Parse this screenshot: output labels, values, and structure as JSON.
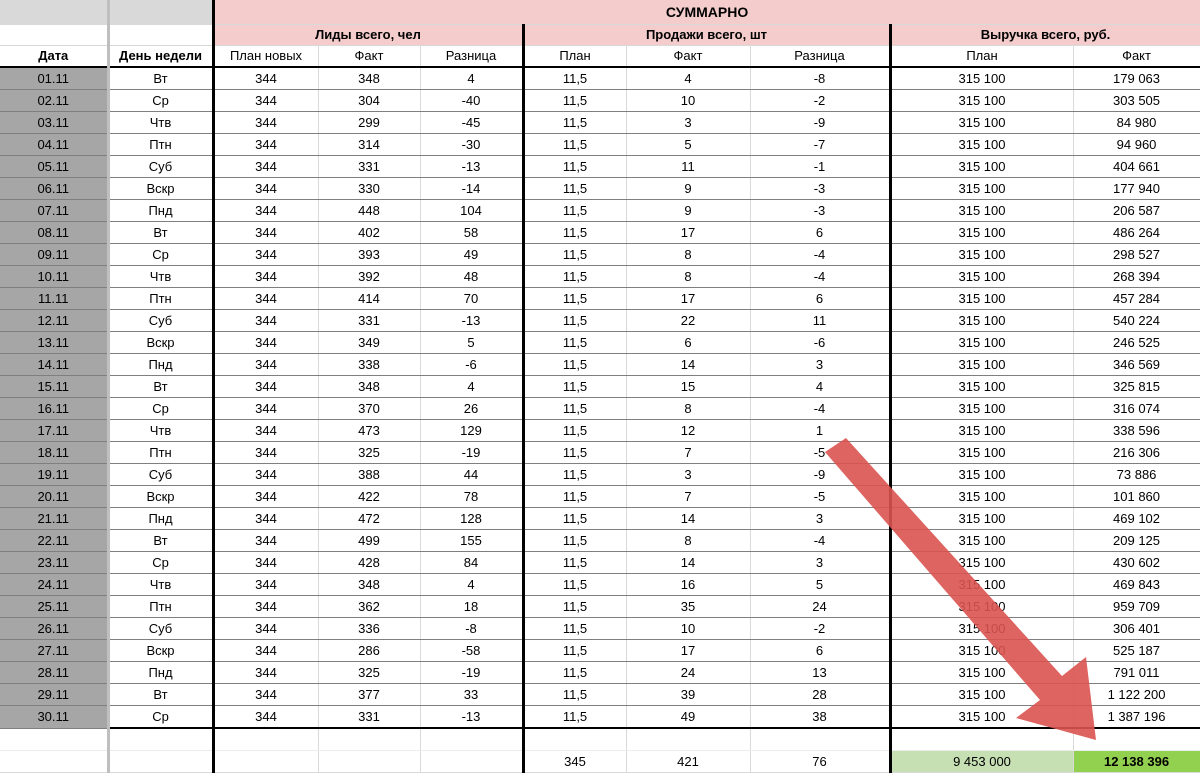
{
  "title": "СУММАРНО",
  "groups": {
    "leads": "Лиды всего, чел",
    "sales": "Продажи всего, шт",
    "revenue": "Выручка всего, руб."
  },
  "headers": {
    "date": "Дата",
    "weekday": "День недели",
    "leads_plan": "План новых",
    "leads_fact": "Факт",
    "leads_diff": "Разница",
    "sales_plan": "План",
    "sales_fact": "Факт",
    "sales_diff": "Разница",
    "rev_plan": "План",
    "rev_fact": "Факт"
  },
  "rows": [
    [
      "01.11",
      "Вт",
      "344",
      "348",
      "4",
      "11,5",
      "4",
      "-8",
      "315 100",
      "179 063"
    ],
    [
      "02.11",
      "Ср",
      "344",
      "304",
      "-40",
      "11,5",
      "10",
      "-2",
      "315 100",
      "303 505"
    ],
    [
      "03.11",
      "Чтв",
      "344",
      "299",
      "-45",
      "11,5",
      "3",
      "-9",
      "315 100",
      "84 980"
    ],
    [
      "04.11",
      "Птн",
      "344",
      "314",
      "-30",
      "11,5",
      "5",
      "-7",
      "315 100",
      "94 960"
    ],
    [
      "05.11",
      "Суб",
      "344",
      "331",
      "-13",
      "11,5",
      "11",
      "-1",
      "315 100",
      "404 661"
    ],
    [
      "06.11",
      "Вскр",
      "344",
      "330",
      "-14",
      "11,5",
      "9",
      "-3",
      "315 100",
      "177 940"
    ],
    [
      "07.11",
      "Пнд",
      "344",
      "448",
      "104",
      "11,5",
      "9",
      "-3",
      "315 100",
      "206 587"
    ],
    [
      "08.11",
      "Вт",
      "344",
      "402",
      "58",
      "11,5",
      "17",
      "6",
      "315 100",
      "486 264"
    ],
    [
      "09.11",
      "Ср",
      "344",
      "393",
      "49",
      "11,5",
      "8",
      "-4",
      "315 100",
      "298 527"
    ],
    [
      "10.11",
      "Чтв",
      "344",
      "392",
      "48",
      "11,5",
      "8",
      "-4",
      "315 100",
      "268 394"
    ],
    [
      "11.11",
      "Птн",
      "344",
      "414",
      "70",
      "11,5",
      "17",
      "6",
      "315 100",
      "457 284"
    ],
    [
      "12.11",
      "Суб",
      "344",
      "331",
      "-13",
      "11,5",
      "22",
      "11",
      "315 100",
      "540 224"
    ],
    [
      "13.11",
      "Вскр",
      "344",
      "349",
      "5",
      "11,5",
      "6",
      "-6",
      "315 100",
      "246 525"
    ],
    [
      "14.11",
      "Пнд",
      "344",
      "338",
      "-6",
      "11,5",
      "14",
      "3",
      "315 100",
      "346 569"
    ],
    [
      "15.11",
      "Вт",
      "344",
      "348",
      "4",
      "11,5",
      "15",
      "4",
      "315 100",
      "325 815"
    ],
    [
      "16.11",
      "Ср",
      "344",
      "370",
      "26",
      "11,5",
      "8",
      "-4",
      "315 100",
      "316 074"
    ],
    [
      "17.11",
      "Чтв",
      "344",
      "473",
      "129",
      "11,5",
      "12",
      "1",
      "315 100",
      "338 596"
    ],
    [
      "18.11",
      "Птн",
      "344",
      "325",
      "-19",
      "11,5",
      "7",
      "-5",
      "315 100",
      "216 306"
    ],
    [
      "19.11",
      "Суб",
      "344",
      "388",
      "44",
      "11,5",
      "3",
      "-9",
      "315 100",
      "73 886"
    ],
    [
      "20.11",
      "Вскр",
      "344",
      "422",
      "78",
      "11,5",
      "7",
      "-5",
      "315 100",
      "101 860"
    ],
    [
      "21.11",
      "Пнд",
      "344",
      "472",
      "128",
      "11,5",
      "14",
      "3",
      "315 100",
      "469 102"
    ],
    [
      "22.11",
      "Вт",
      "344",
      "499",
      "155",
      "11,5",
      "8",
      "-4",
      "315 100",
      "209 125"
    ],
    [
      "23.11",
      "Ср",
      "344",
      "428",
      "84",
      "11,5",
      "14",
      "3",
      "315 100",
      "430 602"
    ],
    [
      "24.11",
      "Чтв",
      "344",
      "348",
      "4",
      "11,5",
      "16",
      "5",
      "315 100",
      "469 843"
    ],
    [
      "25.11",
      "Птн",
      "344",
      "362",
      "18",
      "11,5",
      "35",
      "24",
      "315 100",
      "959 709"
    ],
    [
      "26.11",
      "Суб",
      "344",
      "336",
      "-8",
      "11,5",
      "10",
      "-2",
      "315 100",
      "306 401"
    ],
    [
      "27.11",
      "Вскр",
      "344",
      "286",
      "-58",
      "11,5",
      "17",
      "6",
      "315 100",
      "525 187"
    ],
    [
      "28.11",
      "Пнд",
      "344",
      "325",
      "-19",
      "11,5",
      "24",
      "13",
      "315 100",
      "791 011"
    ],
    [
      "29.11",
      "Вт",
      "344",
      "377",
      "33",
      "11,5",
      "39",
      "28",
      "315 100",
      "1 122 200"
    ],
    [
      "30.11",
      "Ср",
      "344",
      "331",
      "-13",
      "11,5",
      "49",
      "38",
      "315 100",
      "1 387 196"
    ]
  ],
  "totals": {
    "sales_plan": "345",
    "sales_fact": "421",
    "sales_diff": "76",
    "rev_plan": "9 453 000",
    "rev_fact": "12 138 396"
  },
  "colors": {
    "header_pink": "#f4cccc",
    "date_gray": "#a6a6a6",
    "total_green": "#c6e0b4",
    "total_highlight": "#92d050",
    "arrow_red": "#d9534f"
  },
  "annotation": {
    "arrow": "red-arrow-pointing-to-revenue-total"
  }
}
